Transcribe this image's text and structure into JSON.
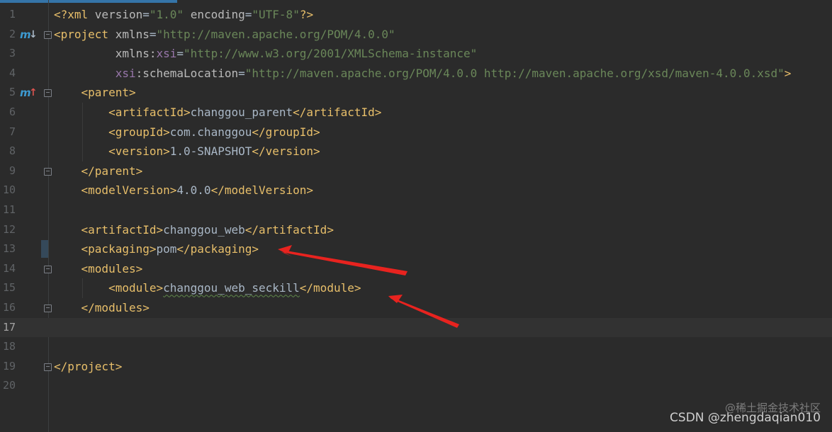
{
  "editor": {
    "lines": [
      {
        "n": "1",
        "segments": [
          [
            "tag",
            "<?xml "
          ],
          [
            "attr",
            "version"
          ],
          [
            "text",
            "="
          ],
          [
            "val",
            "\"1.0\""
          ],
          [
            "text",
            " "
          ],
          [
            "attr",
            "encoding"
          ],
          [
            "text",
            "="
          ],
          [
            "val",
            "\"UTF-8\""
          ],
          [
            "tag",
            "?>"
          ]
        ]
      },
      {
        "n": "2",
        "segments": [
          [
            "tag",
            "<project "
          ],
          [
            "attr",
            "xmlns"
          ],
          [
            "text",
            "="
          ],
          [
            "val",
            "\"http://maven.apache.org/POM/4.0.0\""
          ]
        ]
      },
      {
        "n": "3",
        "segments": [
          [
            "text",
            "         "
          ],
          [
            "attr",
            "xmlns:"
          ],
          [
            "ns",
            "xsi"
          ],
          [
            "text",
            "="
          ],
          [
            "val",
            "\"http://www.w3.org/2001/XMLSchema-instance\""
          ]
        ]
      },
      {
        "n": "4",
        "segments": [
          [
            "text",
            "         "
          ],
          [
            "ns",
            "xsi"
          ],
          [
            "attr",
            ":schemaLocation"
          ],
          [
            "text",
            "="
          ],
          [
            "val",
            "\"http://maven.apache.org/POM/4.0.0 http://maven.apache.org/xsd/maven-4.0.0.xsd\""
          ],
          [
            "tag",
            ">"
          ]
        ]
      },
      {
        "n": "5",
        "segments": [
          [
            "text",
            "    "
          ],
          [
            "tag",
            "<parent>"
          ]
        ]
      },
      {
        "n": "6",
        "segments": [
          [
            "text",
            "        "
          ],
          [
            "tag",
            "<artifactId>"
          ],
          [
            "text",
            "changgou_parent"
          ],
          [
            "tag",
            "</artifactId>"
          ]
        ]
      },
      {
        "n": "7",
        "segments": [
          [
            "text",
            "        "
          ],
          [
            "tag",
            "<groupId>"
          ],
          [
            "text",
            "com.changgou"
          ],
          [
            "tag",
            "</groupId>"
          ]
        ]
      },
      {
        "n": "8",
        "segments": [
          [
            "text",
            "        "
          ],
          [
            "tag",
            "<version>"
          ],
          [
            "text",
            "1.0-SNAPSHOT"
          ],
          [
            "tag",
            "</version>"
          ]
        ]
      },
      {
        "n": "9",
        "segments": [
          [
            "text",
            "    "
          ],
          [
            "tag",
            "</parent>"
          ]
        ]
      },
      {
        "n": "10",
        "segments": [
          [
            "text",
            "    "
          ],
          [
            "tag",
            "<modelVersion>"
          ],
          [
            "text",
            "4.0.0"
          ],
          [
            "tag",
            "</modelVersion>"
          ]
        ]
      },
      {
        "n": "11",
        "segments": []
      },
      {
        "n": "12",
        "segments": [
          [
            "text",
            "    "
          ],
          [
            "tag",
            "<artifactId>"
          ],
          [
            "text",
            "changgou_web"
          ],
          [
            "tag",
            "</artifactId>"
          ]
        ]
      },
      {
        "n": "13",
        "segments": [
          [
            "text",
            "    "
          ],
          [
            "tag",
            "<packaging>"
          ],
          [
            "text",
            "pom"
          ],
          [
            "tag",
            "</packaging>"
          ]
        ]
      },
      {
        "n": "14",
        "segments": [
          [
            "text",
            "    "
          ],
          [
            "tag",
            "<modules>"
          ]
        ]
      },
      {
        "n": "15",
        "segments": [
          [
            "text",
            "        "
          ],
          [
            "tag",
            "<module>"
          ],
          [
            "squiggle",
            "changgou_web_seckill"
          ],
          [
            "tag",
            "</module>"
          ]
        ]
      },
      {
        "n": "16",
        "segments": [
          [
            "text",
            "    "
          ],
          [
            "tag",
            "</modules>"
          ]
        ]
      },
      {
        "n": "17",
        "segments": []
      },
      {
        "n": "18",
        "segments": []
      },
      {
        "n": "19",
        "segments": [
          [
            "tag",
            "</project>"
          ]
        ]
      },
      {
        "n": "20",
        "segments": []
      }
    ],
    "current_line": 17,
    "highlight_line": 13,
    "gutter_icons": {
      "2": "maven-down-icon",
      "5": "maven-up-icon"
    },
    "maven_icon_letter": "m",
    "arrow_down_glyph": "↓",
    "arrow_up_glyph": "↑"
  },
  "watermark": {
    "main": "CSDN @zhengdaqian010",
    "ghost": "@稀土掘金技术社区"
  },
  "colors": {
    "background": "#2b2b2b",
    "tag": "#e8bf6a",
    "attribute": "#bababa",
    "namespace": "#9876aa",
    "string": "#6a8759",
    "text": "#a9b7c6",
    "annotation_arrow": "#e8231f"
  }
}
